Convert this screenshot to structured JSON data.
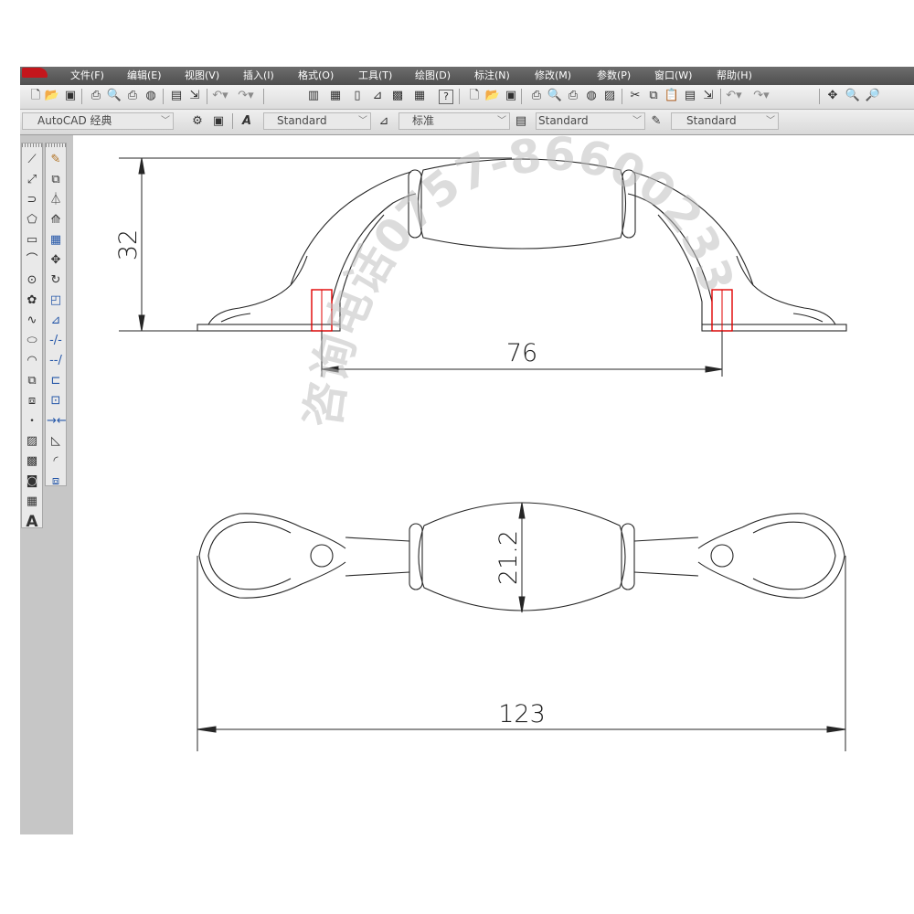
{
  "menu": [
    "文件(F)",
    "编辑(E)",
    "视图(V)",
    "插入(I)",
    "格式(O)",
    "工具(T)",
    "绘图(D)",
    "标注(N)",
    "修改(M)",
    "参数(P)",
    "窗口(W)",
    "帮助(H)"
  ],
  "toolbar2": {
    "workspace": "AutoCAD 经典",
    "text_style": "Standard",
    "dim_style": "标准",
    "table_style": "Standard",
    "multileader_style": "Standard"
  },
  "palette_bottom_label": "A",
  "drawing": {
    "dimensions": {
      "height": "32",
      "hole_spacing": "76",
      "grip_width": "21.2",
      "overall_length": "123"
    },
    "watermark": "咨询电话0757-86600233"
  },
  "colors": {
    "line": "#262626",
    "highlight": "#e00000",
    "menubar": "#5a5a5a",
    "logo": "#c4161c"
  },
  "icons": {
    "toolbar1": [
      "new-icon",
      "open-icon",
      "save-icon",
      "print-icon",
      "print-preview-icon",
      "publish-icon",
      "3d-publish-icon",
      "block-editor-icon",
      "paste-icon",
      "undo-icon",
      "redo-icon",
      "properties-icon",
      "design-center-icon",
      "tool-palette-icon",
      "sheet-set-icon",
      "markup-icon",
      "calculator-icon",
      "help-icon",
      "new-icon",
      "open-icon",
      "save-icon",
      "print-icon",
      "print-preview-icon",
      "plot-icon",
      "publish-icon",
      "etransmit-icon",
      "cut-icon",
      "copy-icon",
      "paste-icon",
      "match-properties-icon",
      "block-icon",
      "undo-icon",
      "redo-icon",
      "pan-icon",
      "zoom-realtime-icon",
      "zoom-window-icon"
    ],
    "draw_palette": [
      "line-icon",
      "construction-line-icon",
      "polyline-icon",
      "polygon-icon",
      "rectangle-icon",
      "arc-icon",
      "circle-icon",
      "revision-cloud-icon",
      "spline-icon",
      "ellipse-icon",
      "ellipse-arc-icon",
      "insert-block-icon",
      "make-block-icon",
      "point-icon",
      "hatch-icon",
      "gradient-icon",
      "region-icon",
      "table-icon",
      "multiline-text-icon"
    ],
    "modify_palette": [
      "erase-icon",
      "copy-object-icon",
      "mirror-icon",
      "offset-icon",
      "array-icon",
      "move-icon",
      "rotate-icon",
      "scale-icon",
      "stretch-icon",
      "trim-icon",
      "extend-icon",
      "break-at-point-icon",
      "break-icon",
      "join-icon",
      "chamfer-icon",
      "fillet-icon",
      "explode-icon"
    ]
  }
}
